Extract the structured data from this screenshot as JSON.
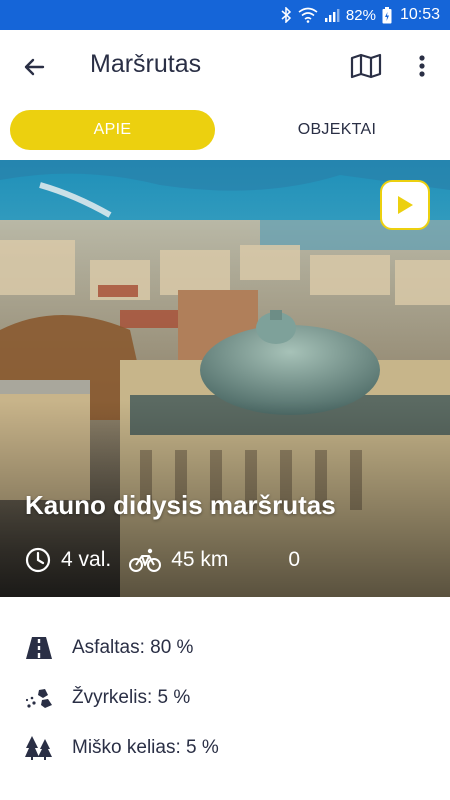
{
  "status_bar": {
    "battery_percent": "82%",
    "time": "10:53",
    "background": "#1565d8"
  },
  "header": {
    "title": "Maršrutas",
    "icons": [
      "arrow-back-icon",
      "map-icon",
      "more-vert-icon"
    ]
  },
  "tabs": [
    {
      "label": "APIE",
      "active": true
    },
    {
      "label": "OBJEKTAI",
      "active": false
    }
  ],
  "route": {
    "name": "Kauno didysis maršrutas",
    "duration": "4 val.",
    "distance": "45 km",
    "count": "0"
  },
  "surfaces": [
    {
      "icon": "asphalt-road-icon",
      "label": "Asfaltas: 80 %"
    },
    {
      "icon": "gravel-icon",
      "label": "Žvyrkelis: 5 %"
    },
    {
      "icon": "forest-road-icon",
      "label": "Miško kelias: 5 %"
    }
  ],
  "colors": {
    "accent": "#ecd00f",
    "text": "#2a2f45",
    "status_bar": "#1565d8"
  }
}
